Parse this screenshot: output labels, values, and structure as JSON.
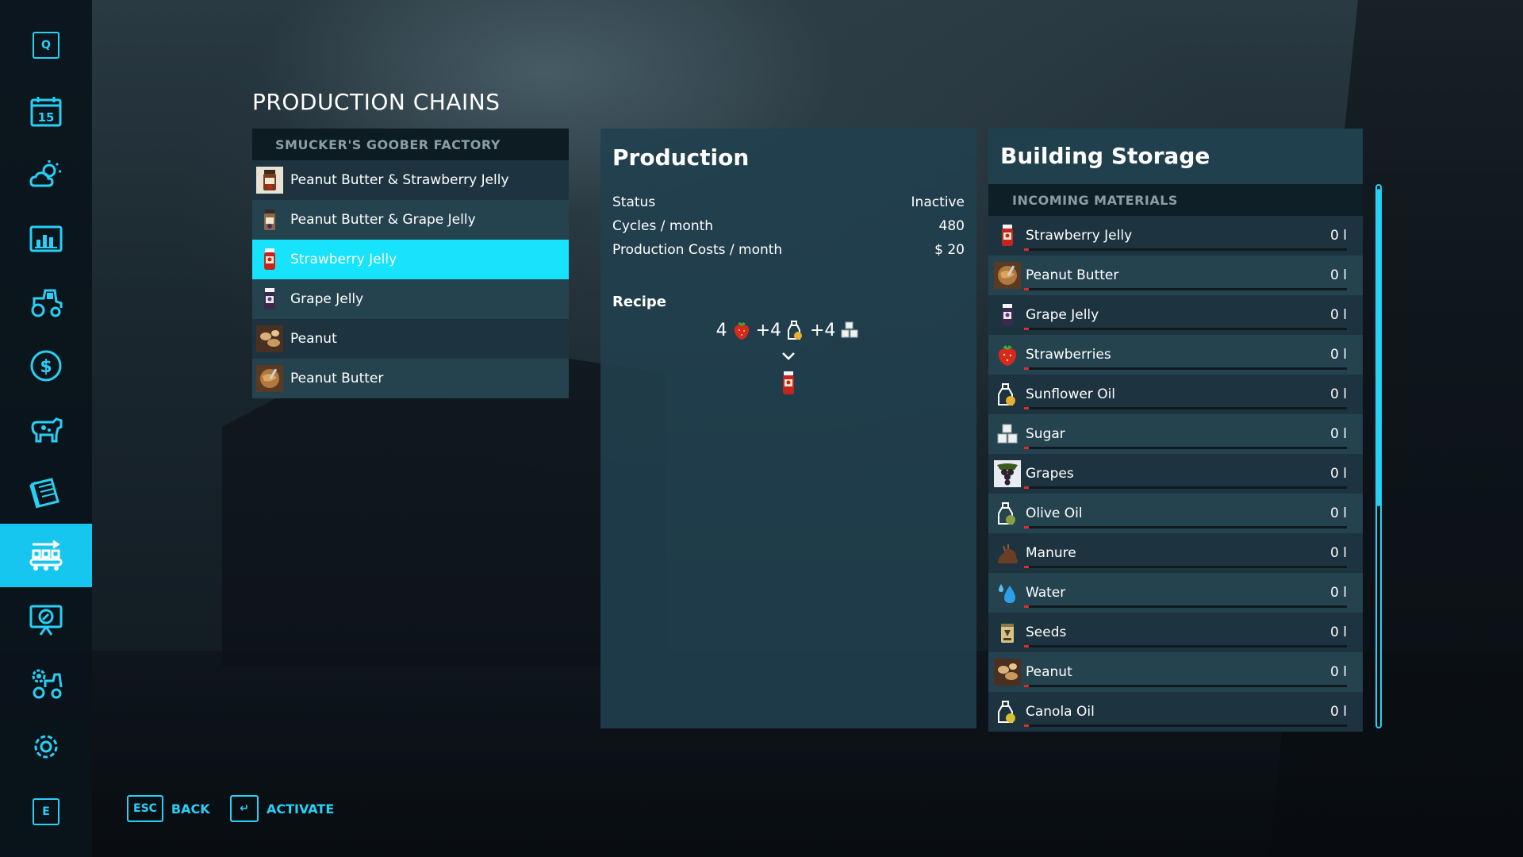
{
  "sidebar": {
    "top_key": "Q",
    "calendar_day": "15",
    "bottom_key": "E",
    "items": [
      {
        "icon": "calendar-icon"
      },
      {
        "icon": "weather-icon"
      },
      {
        "icon": "statistics-icon"
      },
      {
        "icon": "tractor-icon"
      },
      {
        "icon": "finances-icon"
      },
      {
        "icon": "animals-icon"
      },
      {
        "icon": "contracts-icon"
      },
      {
        "icon": "production-icon"
      },
      {
        "icon": "help-icon"
      },
      {
        "icon": "vehicle-settings-icon"
      },
      {
        "icon": "settings-icon"
      }
    ]
  },
  "page": {
    "title": "PRODUCTION CHAINS"
  },
  "chains": {
    "header": "SMUCKER'S GOOBER FACTORY",
    "items": [
      {
        "label": "Peanut Butter & Strawberry Jelly",
        "icon": "pb-strawberry-jar-icon"
      },
      {
        "label": "Peanut Butter & Grape Jelly",
        "icon": "pb-grape-jar-icon"
      },
      {
        "label": "Strawberry Jelly",
        "icon": "strawberry-jelly-icon",
        "selected": true
      },
      {
        "label": "Grape Jelly",
        "icon": "grape-jelly-icon"
      },
      {
        "label": "Peanut",
        "icon": "peanut-icon"
      },
      {
        "label": "Peanut Butter",
        "icon": "peanut-butter-icon"
      }
    ]
  },
  "production": {
    "title": "Production",
    "status_label": "Status",
    "status_value": "Inactive",
    "cycles_label": "Cycles / month",
    "cycles_value": "480",
    "costs_label": "Production Costs / month",
    "costs_value": "$ 20",
    "recipe_label": "Recipe",
    "recipe": {
      "q1": "4",
      "q2": "+4",
      "q3": "+4",
      "inputs": [
        "strawberry-icon",
        "oil-bottle-icon",
        "sugar-icon"
      ],
      "output": "strawberry-jelly-icon"
    }
  },
  "storage": {
    "title": "Building Storage",
    "section": "INCOMING MATERIALS",
    "items": [
      {
        "name": "Strawberry Jelly",
        "value": "0 l",
        "icon": "strawberry-jelly-icon",
        "fill": 0
      },
      {
        "name": "Peanut Butter",
        "value": "0 l",
        "icon": "peanut-butter-icon",
        "fill": 0
      },
      {
        "name": "Grape Jelly",
        "value": "0 l",
        "icon": "grape-jelly-icon",
        "fill": 0
      },
      {
        "name": "Strawberries",
        "value": "0 l",
        "icon": "strawberry-icon",
        "fill": 0
      },
      {
        "name": "Sunflower Oil",
        "value": "0 l",
        "icon": "oil-bottle-icon",
        "fill": 0
      },
      {
        "name": "Sugar",
        "value": "0 l",
        "icon": "sugar-icon",
        "fill": 0
      },
      {
        "name": "Grapes",
        "value": "0 l",
        "icon": "grapes-icon",
        "fill": 0
      },
      {
        "name": "Olive Oil",
        "value": "0 l",
        "icon": "oil-bottle-icon",
        "fill": 0
      },
      {
        "name": "Manure",
        "value": "0 l",
        "icon": "manure-icon",
        "fill": 0
      },
      {
        "name": "Water",
        "value": "0 l",
        "icon": "water-drop-icon",
        "fill": 0
      },
      {
        "name": "Seeds",
        "value": "0 l",
        "icon": "seeds-icon",
        "fill": 0
      },
      {
        "name": "Peanut",
        "value": "0 l",
        "icon": "peanut-icon",
        "fill": 0
      },
      {
        "name": "Canola Oil",
        "value": "0 l",
        "icon": "oil-bottle-icon",
        "fill": 0
      }
    ]
  },
  "footer": {
    "back_key": "ESC",
    "back_label": "BACK",
    "activate_key": "↵",
    "activate_label": "ACTIVATE"
  },
  "colors": {
    "accent": "#28d0f5",
    "selected_row": "#17e3fc",
    "bar_fill": "#e02b2b"
  }
}
